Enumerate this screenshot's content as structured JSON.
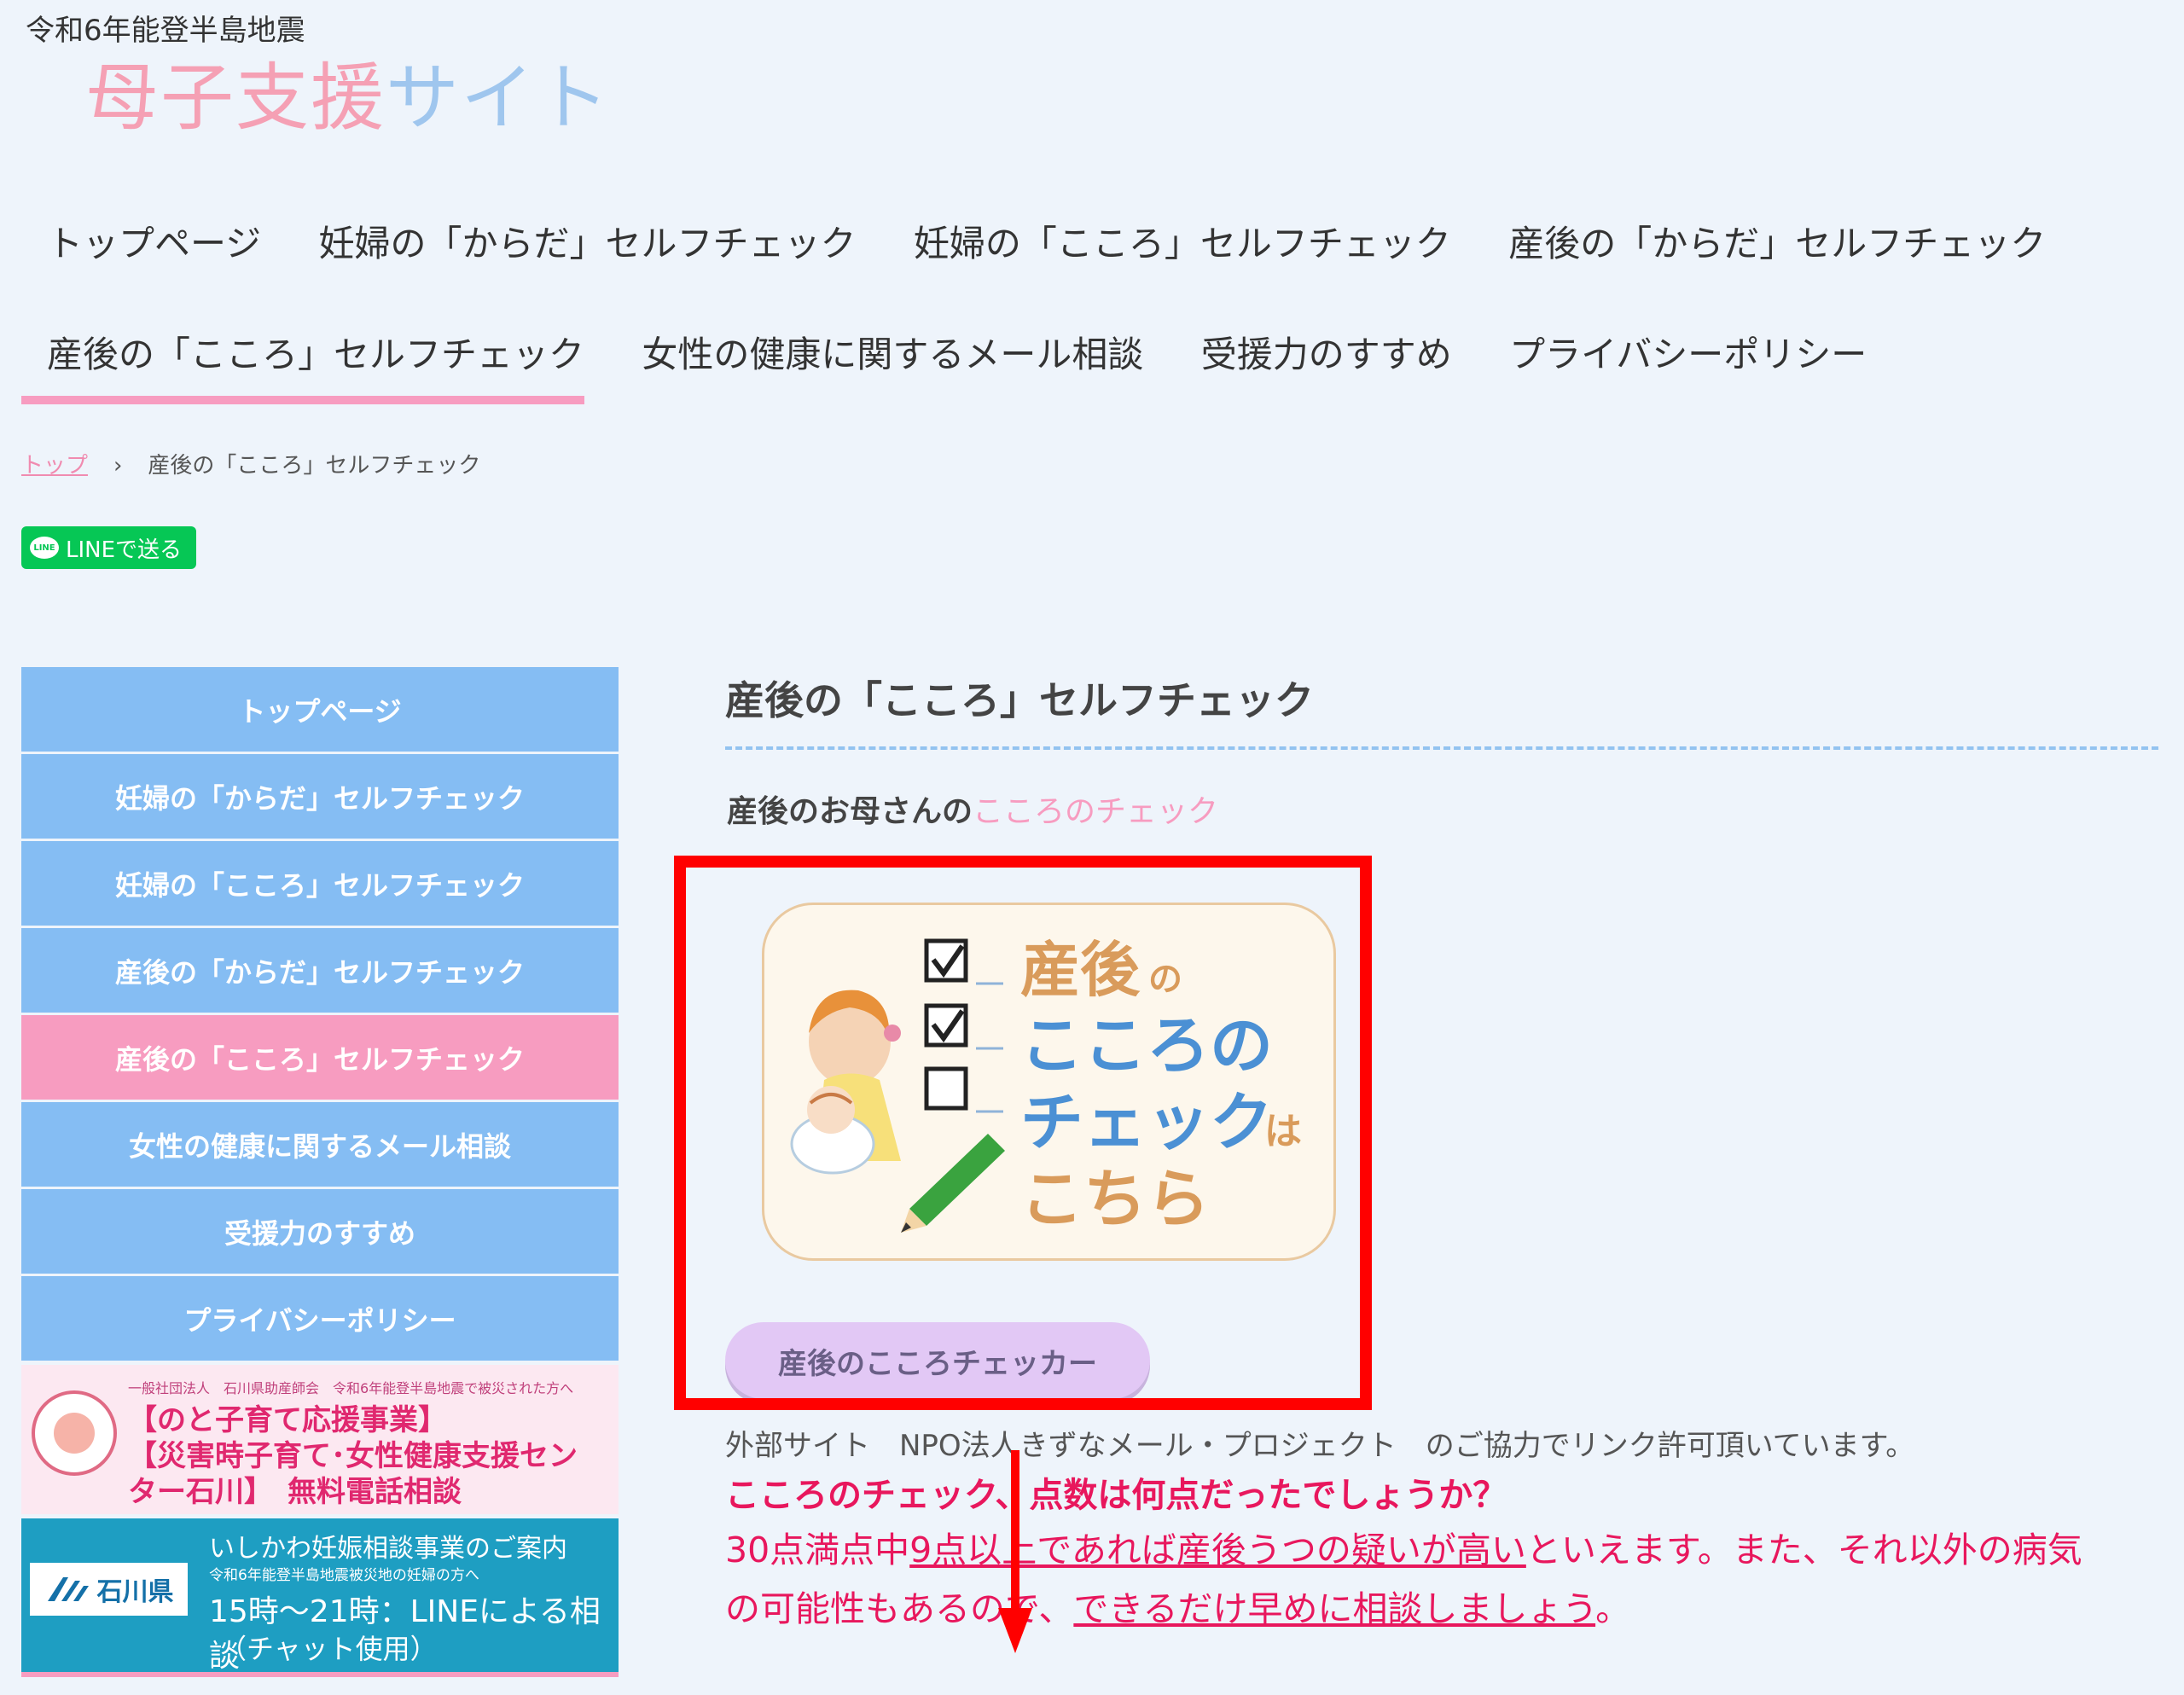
{
  "header": {
    "subtitle": "令和6年能登半島地震",
    "title_part1": "母子支援",
    "title_part2": "サイト"
  },
  "global_nav": {
    "row1": [
      "トップページ",
      "妊婦の「からだ」セルフチェック",
      "妊婦の「こころ」セルフチェック",
      "産後の「からだ」セルフチェック"
    ],
    "row2": [
      "産後の「こころ」セルフチェック",
      "女性の健康に関するメール相談",
      "受援力のすすめ",
      "プライバシーポリシー"
    ],
    "active": "産後の「こころ」セルフチェック"
  },
  "breadcrumb": {
    "home": "トップ",
    "separator": "›",
    "current": "産後の「こころ」セルフチェック"
  },
  "line_button": {
    "icon_text": "LINE",
    "label": "LINEで送る",
    "color": "#06c755"
  },
  "sidebar": {
    "items": [
      "トップページ",
      "妊婦の「からだ」セルフチェック",
      "妊婦の「こころ」セルフチェック",
      "産後の「からだ」セルフチェック",
      "産後の「こころ」セルフチェック",
      "女性の健康に関するメール相談",
      "受援力のすすめ",
      "プライバシーポリシー"
    ],
    "active_index": 4,
    "colors": {
      "item": "#85bdf3",
      "active": "#f79cc0"
    }
  },
  "banners": {
    "nanao": {
      "small": "一般社団法人　石川県助産師会　令和6年能登半島地震で被災された方へ",
      "line1": "【のと子育て応援事業】",
      "line2": "【災害時子育て･女性健康支援セン",
      "line3": "ター石川】　無料電話相談"
    },
    "ishikawa": {
      "pref_mark": "石川県",
      "line1": "いしかわ妊娠相談事業のご案内",
      "line2": "令和6年能登半島地震被災地の妊婦の方へ",
      "line3": "15時～21時：LINEによる相談",
      "line4": "（チャット使用）"
    }
  },
  "main": {
    "heading": "産後の「こころ」セルフチェック",
    "subheading": "産後のお母さんの",
    "subheading_accent": "こころのチェック",
    "card": {
      "title1": "産後",
      "title1_small": "の",
      "title2": "こころの",
      "title3": "チェック",
      "title3_small": "は",
      "title4": "こちら"
    },
    "checker_button": "産後のこころチェッカー",
    "external_note": "外部サイト　NPO法人きずなメール・プロジェクト　のご協力でリンク許可頂いています。",
    "question": "こころのチェック、点数は何点だったでしょうか？",
    "message1_a": "30点満点中",
    "message1_b": "9点以上であれば産後うつの疑いが高い",
    "message1_c": "といえます。また、それ以外の病気",
    "message2_a": "の可能性もあるので、",
    "message2_b": "できるだけ早めに相談しましょう",
    "message2_c": "。"
  }
}
